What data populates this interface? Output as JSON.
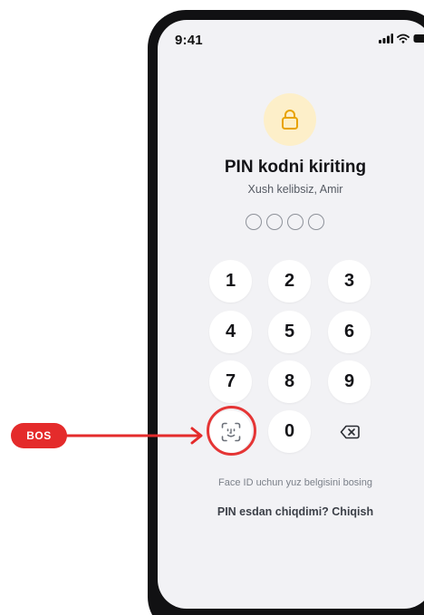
{
  "status_bar": {
    "time": "9:41"
  },
  "lock": {
    "icon": "lock-icon",
    "accent": "#e8a300",
    "bg": "#fdefc9"
  },
  "title": "PIN kodni kiriting",
  "subtitle": "Xush kelibsiz, Amir",
  "pin": {
    "length": 4,
    "filled": 0
  },
  "keypad": {
    "keys": [
      "1",
      "2",
      "3",
      "4",
      "5",
      "6",
      "7",
      "8",
      "9",
      "0"
    ],
    "face_id_icon": "face-id-icon",
    "backspace_icon": "backspace-icon"
  },
  "hint": "Face ID uchun yuz belgisini bosing",
  "forgot_link": "PIN esdan chiqdimi? Chiqish",
  "annotation": {
    "label": "BOS",
    "color": "#e42b2b"
  }
}
